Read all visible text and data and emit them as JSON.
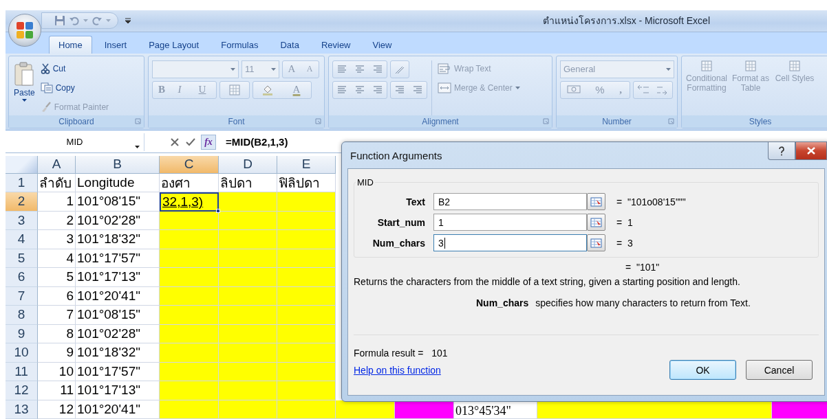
{
  "window": {
    "title": "ตำแหน่งโครงการ.xlsx - Microsoft Excel"
  },
  "tabs": [
    {
      "label": "Home",
      "selected": true
    },
    {
      "label": "Insert",
      "selected": false
    },
    {
      "label": "Page Layout",
      "selected": false
    },
    {
      "label": "Formulas",
      "selected": false
    },
    {
      "label": "Data",
      "selected": false
    },
    {
      "label": "Review",
      "selected": false
    },
    {
      "label": "View",
      "selected": false
    }
  ],
  "ribbon": {
    "groups": [
      {
        "kind": "clipboard",
        "label": "Clipboard",
        "paste": "Paste",
        "items": [
          {
            "label": "Cut",
            "disabled": false
          },
          {
            "label": "Copy",
            "disabled": false
          },
          {
            "label": "Format Painter",
            "disabled": true
          }
        ]
      },
      {
        "kind": "font",
        "label": "Font",
        "disabled": true,
        "size": "11",
        "grow": "A",
        "shrink": "A",
        "bold": "B",
        "italic": "I",
        "underline": "U",
        "color_letter": "A"
      },
      {
        "kind": "alignment",
        "label": "Alignment",
        "disabled": true,
        "wrap": "Wrap Text",
        "merge": "Merge & Center"
      },
      {
        "kind": "number",
        "label": "Number",
        "disabled": true,
        "format": "General",
        "percent": "%",
        "comma": ","
      },
      {
        "kind": "styles",
        "label": "Styles",
        "disabled": true,
        "buttons": [
          "Conditional Formatting",
          "Format as Table",
          "Cell Styles"
        ]
      }
    ]
  },
  "formula_bar": {
    "name_box": "MID",
    "fx": "fx",
    "formula": "=MID(B2,1,3)"
  },
  "sheet": {
    "columns": [
      {
        "label": "A",
        "selected": false
      },
      {
        "label": "B",
        "selected": false
      },
      {
        "label": "C",
        "selected": true,
        "color": "#ffff00"
      },
      {
        "label": "D",
        "selected": false,
        "color": "#ffff00"
      },
      {
        "label": "E",
        "selected": false,
        "color": "#ffff00"
      }
    ],
    "rows": [
      {
        "label": "1",
        "selected": false,
        "cells": [
          "ลำดับ",
          "Longitude",
          "องศา",
          "ลิปดา",
          "ฟิลิปดา"
        ]
      },
      {
        "label": "2",
        "selected": true,
        "cells": [
          "1",
          "101°08'15\"",
          "32,1,3)"
        ]
      },
      {
        "label": "3",
        "selected": false,
        "cells": [
          "2",
          "101°02'28\""
        ]
      },
      {
        "label": "4",
        "selected": false,
        "cells": [
          "3",
          "101°18'32\""
        ]
      },
      {
        "label": "5",
        "selected": false,
        "cells": [
          "4",
          "101°17'57\""
        ]
      },
      {
        "label": "6",
        "selected": false,
        "cells": [
          "5",
          "101°17'13\""
        ]
      },
      {
        "label": "7",
        "selected": false,
        "cells": [
          "6",
          "101°20'41\""
        ]
      },
      {
        "label": "8",
        "selected": false,
        "cells": [
          "7",
          "101°08'15\""
        ]
      },
      {
        "label": "9",
        "selected": false,
        "cells": [
          "8",
          "101°02'28\""
        ]
      },
      {
        "label": "10",
        "selected": false,
        "cells": [
          "9",
          "101°18'32\""
        ]
      },
      {
        "label": "11",
        "selected": false,
        "cells": [
          "10",
          "101°17'57\""
        ]
      },
      {
        "label": "12",
        "selected": false,
        "cells": [
          "11",
          "101°17'13\""
        ]
      },
      {
        "label": "13",
        "selected": false,
        "cells": [
          "12",
          "101°20'41\""
        ],
        "tail": [
          {
            "color": "#ffff00"
          },
          {
            "color": "#ff00ff"
          },
          {
            "color": "#ffffff",
            "text": "013°45'34\""
          },
          {
            "color": "#ffff00"
          },
          {
            "color": "#ff00ff"
          }
        ]
      }
    ]
  },
  "dialog": {
    "title": "Function Arguments",
    "function": "MID",
    "args": [
      {
        "label": "Text",
        "value": "B2",
        "result": "=  \"101o08'15\"\"\"",
        "focused": false
      },
      {
        "label": "Start_num",
        "value": "1",
        "result": "=  1",
        "focused": false
      },
      {
        "label": "Num_chars",
        "value": "3",
        "result": "=  3",
        "focused": true
      }
    ],
    "result": "=  \"101\"",
    "description": "Returns the characters from the middle of a text string, given a starting position and length.",
    "arg_help": {
      "name": "Num_chars",
      "text": "specifies how many characters to return from Text."
    },
    "formula_result": "Formula result =   101",
    "help_link": "Help on this function",
    "buttons": [
      {
        "label": "OK",
        "default": true
      },
      {
        "label": "Cancel",
        "default": false
      }
    ]
  }
}
